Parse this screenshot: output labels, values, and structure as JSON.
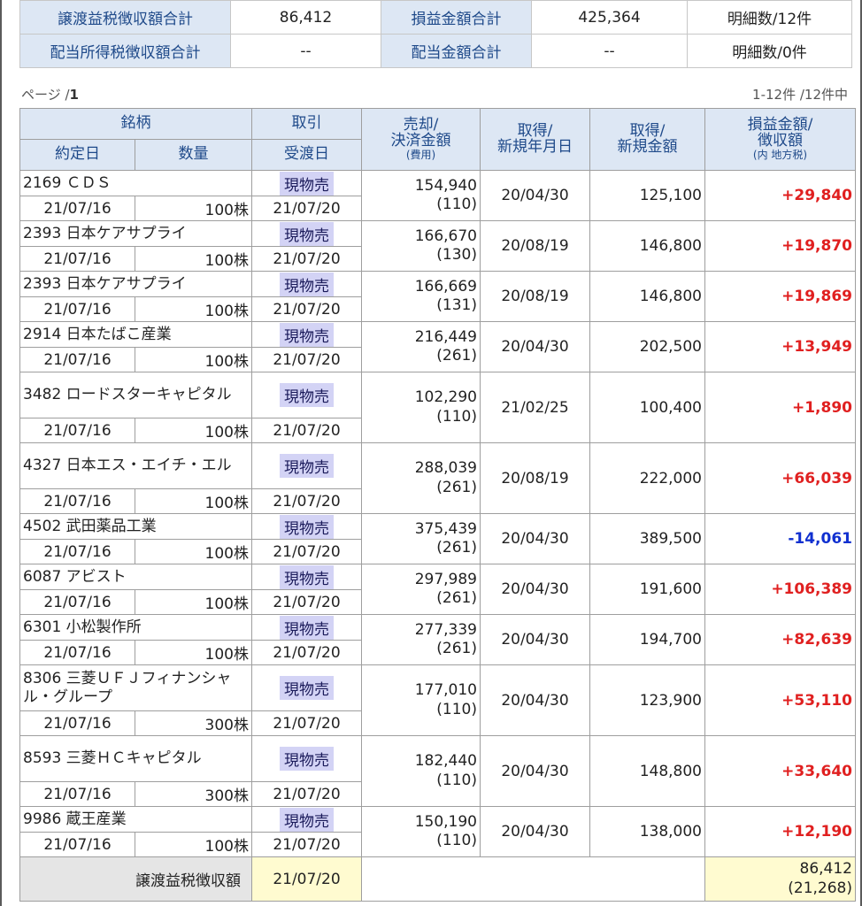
{
  "summary": {
    "rows": [
      {
        "label1": "譲渡益税徴収額合計",
        "value1": "86,412",
        "label2": "損益金額合計",
        "value2": "425,364",
        "count": "明細数/12件"
      },
      {
        "label1": "配当所得税徴収額合計",
        "value1": "--",
        "label2": "配当金額合計",
        "value2": "--",
        "count": "明細数/0件"
      }
    ]
  },
  "pager": {
    "page_prefix": "ページ /",
    "page_num": "1",
    "range": "1-12件 /12件中"
  },
  "headers": {
    "meigara": "銘柄",
    "torihiki": "取引",
    "baikyaku_1": "売却/",
    "baikyaku_2": "決済金額",
    "baikyaku_3": "(費用)",
    "shutoku_date_1": "取得/",
    "shutoku_date_2": "新規年月日",
    "shutoku_amt_1": "取得/",
    "shutoku_amt_2": "新規金額",
    "pl_1": "損益金額/",
    "pl_2": "徴収額",
    "pl_3": "(内 地方税)",
    "yakujo": "約定日",
    "suryo": "数量",
    "ukewatashi": "受渡日"
  },
  "rows": [
    {
      "name": "2169 ＣＤＳ",
      "trade": "現物売",
      "sale": "154,940",
      "fee": "(110)",
      "acq_date": "20/04/30",
      "acq_amount": "125,100",
      "pl": "+29,840",
      "pl_type": "gain",
      "exec_date": "21/07/16",
      "qty": "100株",
      "settle_date": "21/07/20"
    },
    {
      "name": "2393 日本ケアサプライ",
      "trade": "現物売",
      "sale": "166,670",
      "fee": "(130)",
      "acq_date": "20/08/19",
      "acq_amount": "146,800",
      "pl": "+19,870",
      "pl_type": "gain",
      "exec_date": "21/07/16",
      "qty": "100株",
      "settle_date": "21/07/20"
    },
    {
      "name": "2393 日本ケアサプライ",
      "trade": "現物売",
      "sale": "166,669",
      "fee": "(131)",
      "acq_date": "20/08/19",
      "acq_amount": "146,800",
      "pl": "+19,869",
      "pl_type": "gain",
      "exec_date": "21/07/16",
      "qty": "100株",
      "settle_date": "21/07/20"
    },
    {
      "name": "2914 日本たばこ産業",
      "trade": "現物売",
      "sale": "216,449",
      "fee": "(261)",
      "acq_date": "20/04/30",
      "acq_amount": "202,500",
      "pl": "+13,949",
      "pl_type": "gain",
      "exec_date": "21/07/16",
      "qty": "100株",
      "settle_date": "21/07/20"
    },
    {
      "name": "3482 ロードスターキャピタル",
      "trade": "現物売",
      "sale": "102,290",
      "fee": "(110)",
      "acq_date": "21/02/25",
      "acq_amount": "100,400",
      "pl": "+1,890",
      "pl_type": "gain",
      "exec_date": "21/07/16",
      "qty": "100株",
      "settle_date": "21/07/20"
    },
    {
      "name": "4327 日本エス・エイチ・エル",
      "trade": "現物売",
      "sale": "288,039",
      "fee": "(261)",
      "acq_date": "20/08/19",
      "acq_amount": "222,000",
      "pl": "+66,039",
      "pl_type": "gain",
      "exec_date": "21/07/16",
      "qty": "100株",
      "settle_date": "21/07/20"
    },
    {
      "name": "4502 武田薬品工業",
      "trade": "現物売",
      "sale": "375,439",
      "fee": "(261)",
      "acq_date": "20/04/30",
      "acq_amount": "389,500",
      "pl": "-14,061",
      "pl_type": "loss",
      "exec_date": "21/07/16",
      "qty": "100株",
      "settle_date": "21/07/20"
    },
    {
      "name": "6087 アビスト",
      "trade": "現物売",
      "sale": "297,989",
      "fee": "(261)",
      "acq_date": "20/04/30",
      "acq_amount": "191,600",
      "pl": "+106,389",
      "pl_type": "gain",
      "exec_date": "21/07/16",
      "qty": "100株",
      "settle_date": "21/07/20"
    },
    {
      "name": "6301 小松製作所",
      "trade": "現物売",
      "sale": "277,339",
      "fee": "(261)",
      "acq_date": "20/04/30",
      "acq_amount": "194,700",
      "pl": "+82,639",
      "pl_type": "gain",
      "exec_date": "21/07/16",
      "qty": "100株",
      "settle_date": "21/07/20"
    },
    {
      "name": "8306 三菱ＵＦＪフィナンシャル・グループ",
      "trade": "現物売",
      "sale": "177,010",
      "fee": "(110)",
      "acq_date": "20/04/30",
      "acq_amount": "123,900",
      "pl": "+53,110",
      "pl_type": "gain",
      "exec_date": "21/07/16",
      "qty": "300株",
      "settle_date": "21/07/20"
    },
    {
      "name": "8593 三菱ＨＣキャピタル",
      "trade": "現物売",
      "sale": "182,440",
      "fee": "(110)",
      "acq_date": "20/04/30",
      "acq_amount": "148,800",
      "pl": "+33,640",
      "pl_type": "gain",
      "exec_date": "21/07/16",
      "qty": "300株",
      "settle_date": "21/07/20"
    },
    {
      "name": "9986 蔵王産業",
      "trade": "現物売",
      "sale": "150,190",
      "fee": "(110)",
      "acq_date": "20/04/30",
      "acq_amount": "138,000",
      "pl": "+12,190",
      "pl_type": "gain",
      "exec_date": "21/07/16",
      "qty": "100株",
      "settle_date": "21/07/20"
    }
  ],
  "totals": {
    "label": "譲渡益税徴収額",
    "date": "21/07/20",
    "amount": "86,412",
    "local_tax": "(21,268)"
  },
  "colors": {
    "gain": "#e02020",
    "loss": "#1030d0",
    "header_bg": "#dde7f4",
    "trade_badge": "#d3d3f5",
    "total_yellow": "#fffbd0"
  }
}
